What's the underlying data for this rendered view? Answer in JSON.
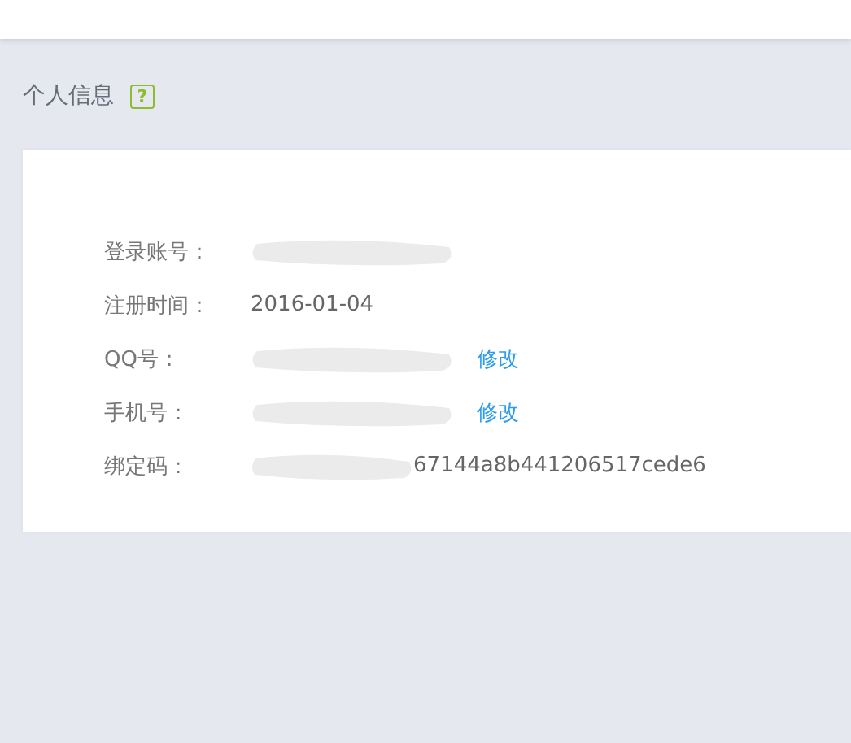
{
  "section": {
    "title": "个人信息",
    "help": "?"
  },
  "rows": [
    {
      "label": "登录账号：",
      "redacted": true
    },
    {
      "label": "注册时间：",
      "value": "2016-01-04",
      "redacted": false
    },
    {
      "label": "QQ号：",
      "redacted": true,
      "action": "修改"
    },
    {
      "label": "手机号：",
      "redacted": true,
      "action": "修改"
    },
    {
      "label": "绑定码：",
      "redacted": true,
      "value": "67144a8b441206517cede6"
    }
  ]
}
